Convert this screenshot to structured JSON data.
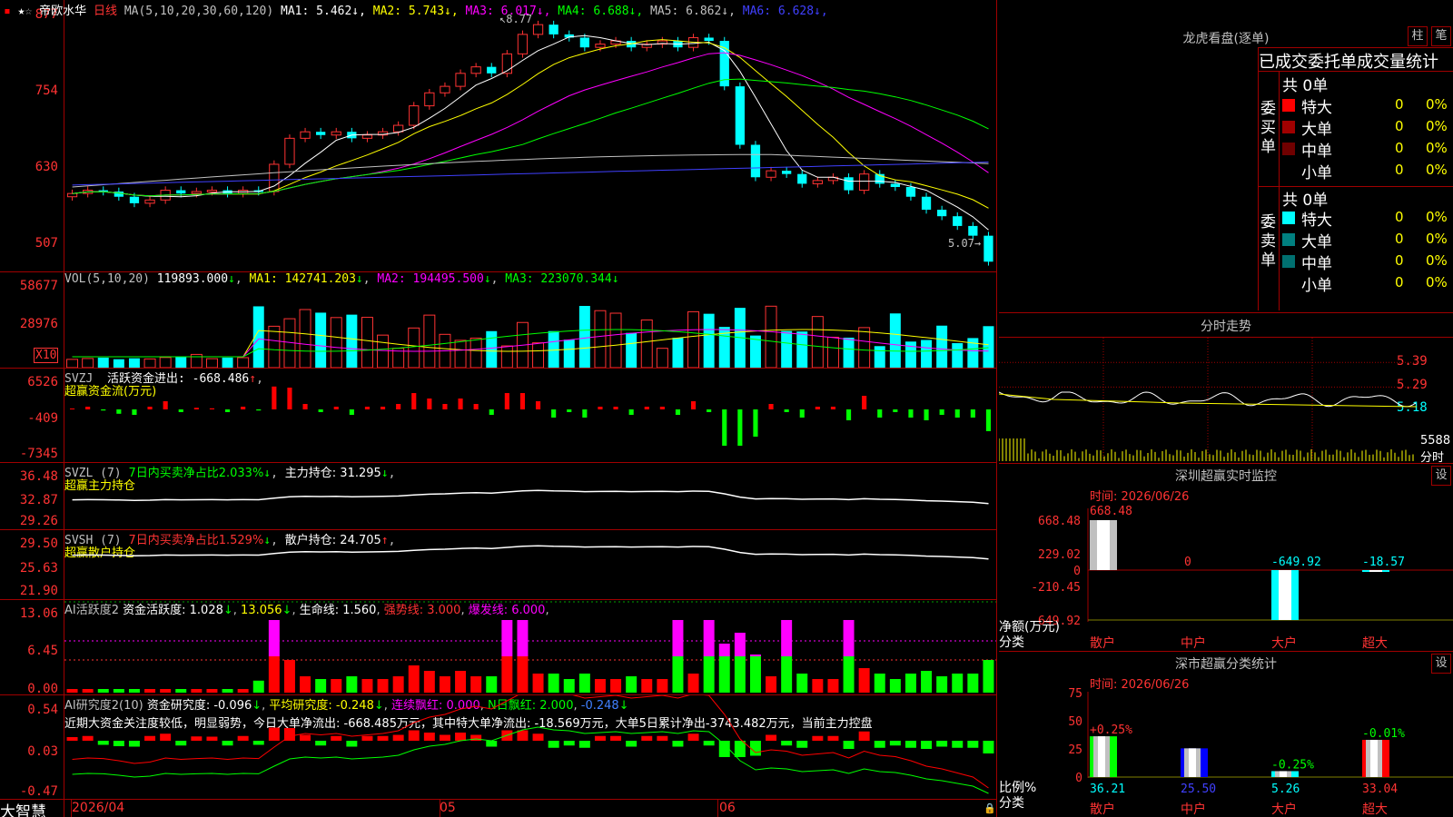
{
  "stock": {
    "name": "帝欧水华",
    "period": "日线",
    "ma_label": "MA(5,10,20,30,60,120)",
    "ma": [
      {
        "label": "MA1:",
        "value": "5.462",
        "color": "#ffffff"
      },
      {
        "label": "MA2:",
        "value": "5.743",
        "color": "#ffff00"
      },
      {
        "label": "MA3:",
        "value": "6.017",
        "color": "#ff00ff"
      },
      {
        "label": "MA4:",
        "value": "6.688",
        "color": "#00ff00"
      },
      {
        "label": "MA5:",
        "value": "6.862",
        "color": "#c0c0c0"
      },
      {
        "label": "MA6:",
        "value": "6.628",
        "color": "#4040ff"
      }
    ],
    "high_label": "8.77",
    "low_label": "5.07"
  },
  "axes": {
    "price": [
      "877",
      "754",
      "630",
      "507"
    ],
    "vol": [
      "58677",
      "28976"
    ],
    "vol_unit": "X10",
    "svzj": [
      "6526",
      "-409",
      "-7345"
    ],
    "svzl": [
      "36.48",
      "32.87",
      "29.26"
    ],
    "svsh": [
      "29.50",
      "25.63",
      "21.90"
    ],
    "ai": [
      "13.06",
      "6.45",
      "0.00"
    ],
    "air": [
      "0.54",
      "0.03",
      "-0.47"
    ]
  },
  "vol_header": {
    "title": "VOL(5,10,20)",
    "v": "119893.000",
    "ma1": "MA1: 142741.203",
    "ma2": "MA2: 194495.500",
    "ma3": "MA3: 223070.344"
  },
  "svzj_header": {
    "title": "SVZJ",
    "label": "活跃资金进出: -668.486",
    "sub": "超赢资金流(万元)"
  },
  "svzl_header": {
    "title": "SVZL (7)",
    "label1": "7日内买卖净占比2.033%",
    "label2": "主力持仓: 31.295",
    "sub": "超赢主力持仓"
  },
  "svsh_header": {
    "title": "SVSH (7)",
    "label1": "7日内买卖净占比1.529%",
    "label2": "散户持仓: 24.705",
    "sub": "超赢散户持仓"
  },
  "ai_header": {
    "title": "AI活跃度2",
    "label1": "资金活跃度: 1.028",
    "label2": "13.056",
    "label3": "生命线: 1.560",
    "label4": "强势线: 3.000",
    "label5": "爆发线: 6.000"
  },
  "air_header": {
    "title": "AI研究度2(10)",
    "label1": "资金研究度: -0.096",
    "label2": "平均研究度: -0.248",
    "label3": "连续飘红: 0.000",
    "label4": "N日飘红: 2.000",
    "label5": "-0.248"
  },
  "comment": "近期大资金关注度较低，明显弱势，今日大单净流出: -668.485万元，其中特大单净流出: -18.569万元，大单5日累计净出-3743.482万元，当前主力控盘",
  "bottom": {
    "brand": "大智慧",
    "d1": "2026/04",
    "d2": "05",
    "d3": "06"
  },
  "right": {
    "lhb_title": "龙虎看盘(逐单)",
    "btn1": "柱",
    "btn2": "笔",
    "stat_title": "已成交委托单成交量统计",
    "buy_side": "委买单",
    "sell_side": "委卖单",
    "buy_total": "共 0单",
    "sell_total": "共 0单",
    "buy_rows": [
      {
        "name": "特大",
        "n": "0",
        "p": "0%",
        "color": "#ff0000"
      },
      {
        "name": "大单",
        "n": "0",
        "p": "0%",
        "color": "#a00000"
      },
      {
        "name": "中单",
        "n": "0",
        "p": "0%",
        "color": "#700000"
      },
      {
        "name": "小单",
        "n": "0",
        "p": "0%",
        "color": "#000000"
      }
    ],
    "sell_rows": [
      {
        "name": "特大",
        "n": "0",
        "p": "0%",
        "color": "#00ffff"
      },
      {
        "name": "大单",
        "n": "0",
        "p": "0%",
        "color": "#008080"
      },
      {
        "name": "中单",
        "n": "0",
        "p": "0%",
        "color": "#007070"
      },
      {
        "name": "小单",
        "n": "0",
        "p": "0%",
        "color": "#000000"
      }
    ],
    "fs_title": "分时走势",
    "fs_axis": [
      "5.39",
      "5.29",
      "5.18"
    ],
    "fs_vol": "5588",
    "fs_unit": "分时",
    "sz_title": "深圳超赢实时监控",
    "sz_btn": "设",
    "sz_time": "时间: 2026/06/26",
    "sz_axis": [
      "668.48",
      "229.02",
      "0",
      "-210.45",
      "-649.92"
    ],
    "sz_values": [
      "668.48",
      "0",
      "-649.92",
      "-18.57"
    ],
    "sz_unit1": "净额(万元)",
    "sz_unit2": "分类",
    "cats": [
      "散户",
      "中户",
      "大户",
      "超大"
    ],
    "ss_title": "深市超赢分类统计",
    "ss_btn": "设",
    "ss_time": "时间: 2026/06/26",
    "ss_axis": [
      "75",
      "50",
      "25",
      "0"
    ],
    "ss_top": [
      "+0.25%",
      "",
      "-0.25%",
      "-0.01%"
    ],
    "ss_values": [
      "36.21",
      "25.50",
      "5.26",
      "33.04"
    ],
    "ss_unit1": "比例%",
    "ss_unit2": "分类"
  },
  "colors": {
    "up": "#ff3333",
    "down": "#00ffff",
    "grid": "#a00000"
  }
}
